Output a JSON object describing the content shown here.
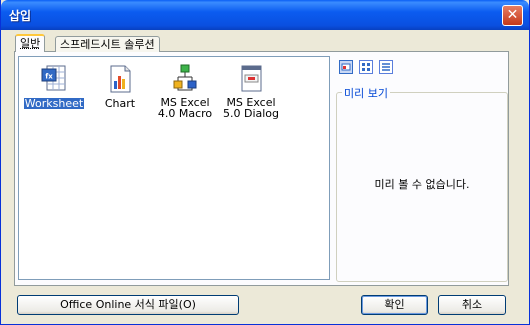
{
  "window": {
    "title": "삽입"
  },
  "tabs": [
    {
      "label": "일반",
      "active": true
    },
    {
      "label": "스프레드시트 솔루션",
      "active": false
    }
  ],
  "items": [
    {
      "label_lines": [
        "Worksheet"
      ],
      "icon": "worksheet-icon",
      "selected": true
    },
    {
      "label_lines": [
        "Chart"
      ],
      "icon": "chart-icon",
      "selected": false
    },
    {
      "label_lines": [
        "MS Excel",
        "4.0 Macro"
      ],
      "icon": "macro-icon",
      "selected": false
    },
    {
      "label_lines": [
        "MS Excel",
        "5.0 Dialog"
      ],
      "icon": "dialog-icon",
      "selected": false
    }
  ],
  "view_buttons": [
    {
      "icon": "large-icons-view-icon",
      "active": true
    },
    {
      "icon": "list-view-icon",
      "active": false
    },
    {
      "icon": "details-view-icon",
      "active": false
    }
  ],
  "preview": {
    "legend": "미리 보기",
    "message": "미리 볼 수 없습니다."
  },
  "buttons": {
    "office_online": "Office Online 서식 파일(O)",
    "ok": "확인",
    "cancel": "취소"
  },
  "colors": {
    "title_bar": "#0A4FE0",
    "selection": "#316AC5",
    "dialog_bg": "#ECE9D8",
    "legend_text": "#0046D5"
  }
}
